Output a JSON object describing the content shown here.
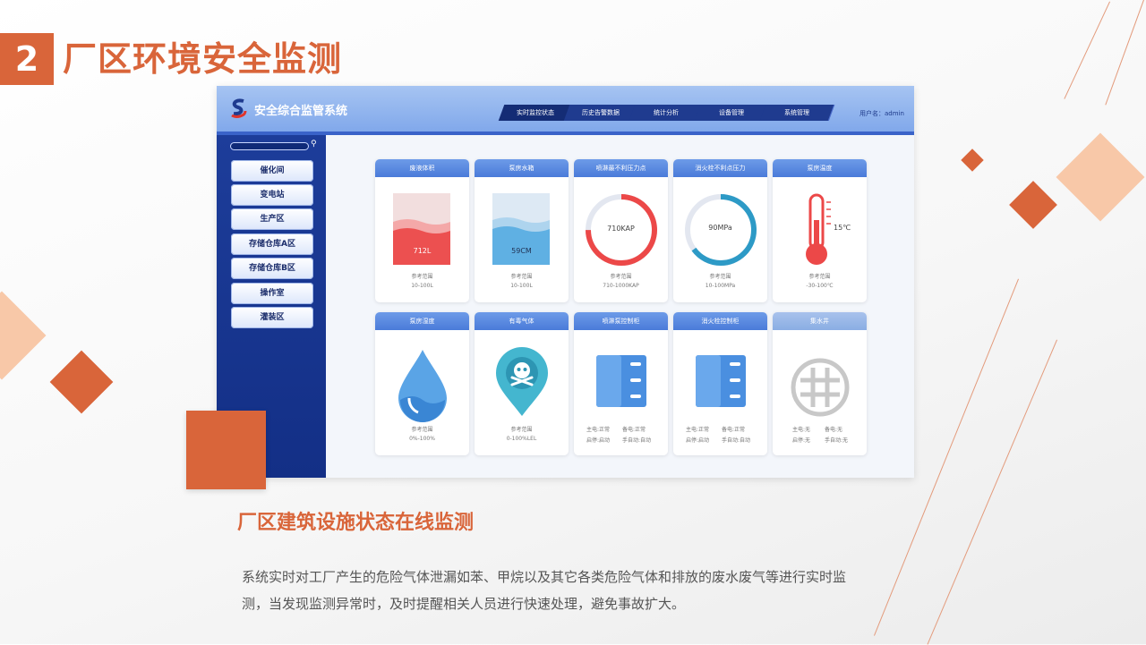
{
  "slide": {
    "number": "2",
    "title": "厂区环境安全监测",
    "subtitle": "厂区建筑设施状态在线监测",
    "paragraph": "系统实时对工厂产生的危险气体泄漏如苯、甲烷以及其它各类危险气体和排放的废水废气等进行实时监测，当发现监测异常时，及时提醒相关人员进行快速处理，避免事故扩大。",
    "accent_color": "#d9653a"
  },
  "app": {
    "title": "安全综合监管系统",
    "nav": [
      "实时监控状态",
      "历史告警数据",
      "统计分析",
      "设备管理",
      "系统管理"
    ],
    "active_nav": "实时监控状态",
    "user": "用户名：admin",
    "sidebar": [
      "催化间",
      "变电站",
      "生产区",
      "存储仓库A区",
      "存储仓库B区",
      "操作室",
      "灌装区"
    ],
    "cards_row1": [
      {
        "title": "废液体积",
        "value": "712L",
        "range_label": "参考范围",
        "range": "10-100L",
        "icon": "tank-red"
      },
      {
        "title": "泵房水箱",
        "value": "59CM",
        "range_label": "参考范围",
        "range": "10-100L",
        "icon": "tank-blue"
      },
      {
        "title": "喷淋最不利压力点",
        "value": "710KAP",
        "range_label": "参考范围",
        "range": "710-1000KAP",
        "icon": "gauge-red",
        "level": 0.75
      },
      {
        "title": "消火栓不利点压力",
        "value": "90MPa",
        "range_label": "参考范围",
        "range": "10-100MPa",
        "icon": "gauge-blue",
        "level": 0.65
      },
      {
        "title": "泵房温度",
        "value": "15℃",
        "range_label": "参考范围",
        "range": "-30-100℃",
        "icon": "thermometer"
      }
    ],
    "cards_row2": [
      {
        "title": "泵房湿度",
        "range_label": "参考范围",
        "range": "0%-100%",
        "icon": "water-drop"
      },
      {
        "title": "有毒气体",
        "range_label": "参考范围",
        "range": "0-100%LEL",
        "icon": "skull-pin"
      },
      {
        "title": "喷淋泵控制柜",
        "status1": "主电:正常",
        "status2": "备电:正常",
        "status3": "启停:启动",
        "status4": "手自动:自动",
        "icon": "cabinet"
      },
      {
        "title": "消火栓控制柜",
        "status1": "主电:正常",
        "status2": "备电:正常",
        "status3": "启停:启动",
        "status4": "手自动:自动",
        "icon": "cabinet"
      },
      {
        "title": "集水井",
        "status1": "主电:无",
        "status2": "备电:无",
        "status3": "启停:无",
        "status4": "手自动:无",
        "icon": "well-grate"
      }
    ]
  }
}
